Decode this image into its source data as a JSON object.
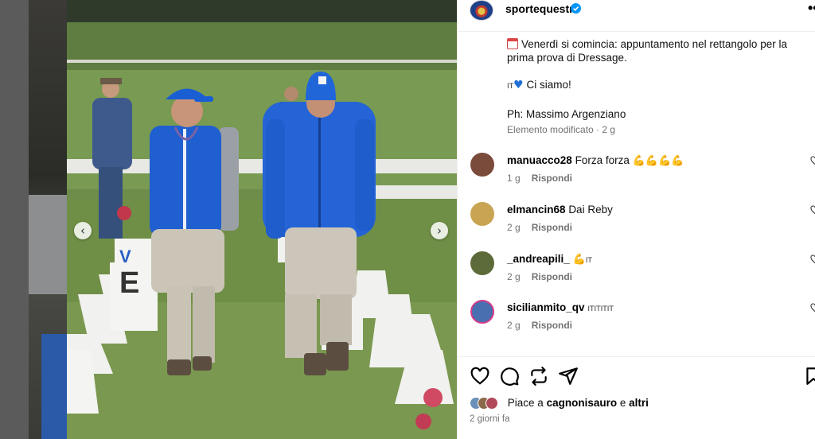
{
  "header": {
    "username": "sportequestri",
    "more_icon": "••"
  },
  "caption": {
    "line1": "Venerdì si comincia: appuntamento nel rettangolo per la prima prova di Dressage.",
    "line2_flag": "IT",
    "line2_heart": "♥",
    "line2_text": "Ci siamo!",
    "line3": "Ph: Massimo Argenziano",
    "edited": "Elemento modificato · 2 g"
  },
  "comments": [
    {
      "user": "manuacco28",
      "text": "Forza forza",
      "emoji": "💪💪💪💪",
      "age": "1 g",
      "reply": "Rispondi"
    },
    {
      "user": "elmancin68",
      "text": "Dai Reby",
      "emoji": "",
      "age": "2 g",
      "reply": "Rispondi"
    },
    {
      "user": "_andreapili_",
      "text": "",
      "emoji": "💪",
      "flag": "IT",
      "age": "2 g",
      "reply": "Rispondi"
    },
    {
      "user": "sicilianmito_qv",
      "text": "",
      "emoji": "",
      "flag": "ITITITIT",
      "age": "2 g",
      "reply": "Rispondi"
    }
  ],
  "likes": {
    "prefix": "Piace a",
    "user": "cagnonisauro",
    "conj": "e",
    "others": "altri"
  },
  "time": "2 giorni fa",
  "photo": {
    "sign_letter": "E",
    "sign_letter2": "V"
  },
  "nav": {
    "prev": "‹",
    "next": "›"
  },
  "colors": {
    "verified": "#0095f6",
    "jacket": "#1f63d6",
    "grass": "#6f8f4e"
  }
}
